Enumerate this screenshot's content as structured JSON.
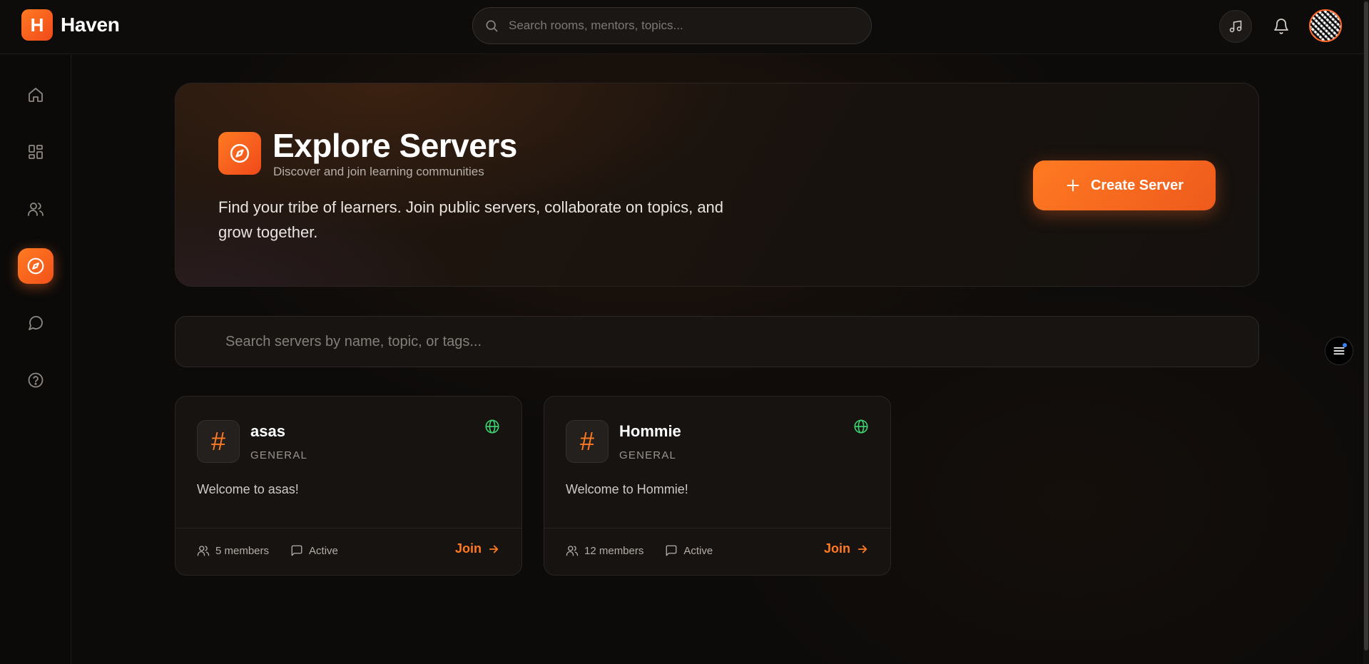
{
  "app": {
    "logo_letter": "H",
    "name": "Haven"
  },
  "top_search": {
    "placeholder": "Search rooms, mentors, topics..."
  },
  "sidebar": {
    "items": [
      {
        "name": "home",
        "icon": "home-icon",
        "active": false
      },
      {
        "name": "dashboard",
        "icon": "grid-icon",
        "active": false
      },
      {
        "name": "people",
        "icon": "users-icon",
        "active": false
      },
      {
        "name": "explore",
        "icon": "compass-icon",
        "active": true
      },
      {
        "name": "messages",
        "icon": "chat-icon",
        "active": false
      },
      {
        "name": "help",
        "icon": "help-icon",
        "active": false
      }
    ]
  },
  "hero": {
    "title": "Explore Servers",
    "subtitle": "Discover and join learning communities",
    "description": "Find your tribe of learners. Join public servers, collaborate on topics, and grow together.",
    "create_label": "Create Server"
  },
  "server_search": {
    "placeholder": "Search servers by name, topic, or tags..."
  },
  "servers": [
    {
      "name": "asas",
      "category": "GENERAL",
      "welcome": "Welcome to asas!",
      "members": "5 members",
      "status": "Active",
      "join_label": "Join"
    },
    {
      "name": "Hommie",
      "category": "GENERAL",
      "welcome": "Welcome to Hommie!",
      "members": "12 members",
      "status": "Active",
      "join_label": "Join"
    }
  ],
  "colors": {
    "accent": "#ff7a22",
    "public": "#3ecf6e",
    "background": "#0d0b0a"
  }
}
